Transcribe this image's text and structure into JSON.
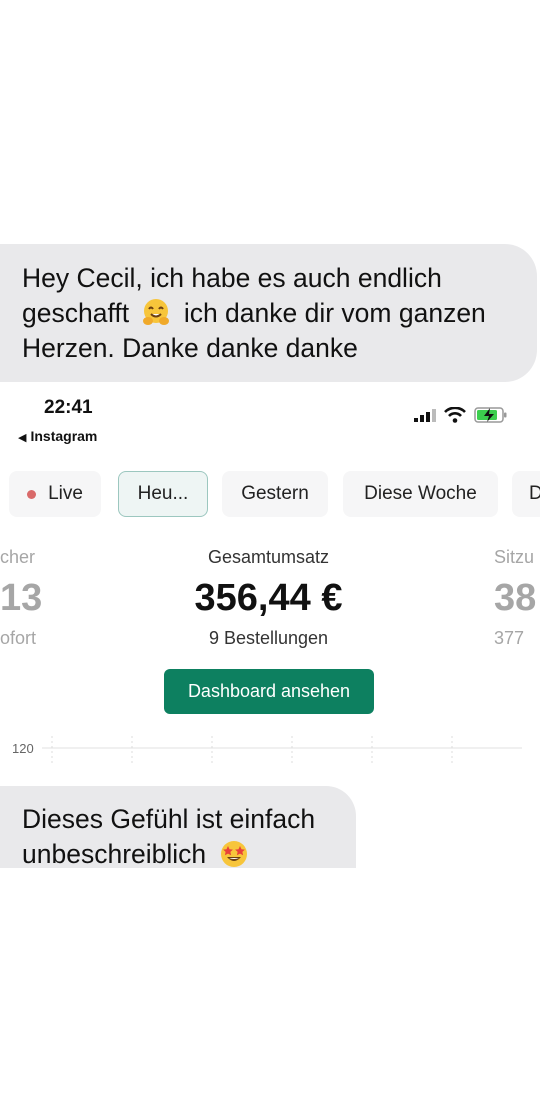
{
  "messages": {
    "first": {
      "line1": "Hey Cecil, ich habe es auch endlich",
      "line2_before": "geschafft",
      "line2_after": "ich danke dir vom ganzen",
      "line3": "Herzen. Danke danke danke"
    },
    "second": {
      "line1": "Dieses Gefühl ist einfach",
      "line2": "unbeschreiblich"
    }
  },
  "status_bar": {
    "time": "22:41",
    "back_app": "Instagram"
  },
  "filters": {
    "live": "Live",
    "today": "Heu...",
    "yesterday": "Gestern",
    "this_week": "Diese Woche",
    "next_cut": "D"
  },
  "stats": {
    "left": {
      "label": "cher",
      "value": "13",
      "sub": "ofort"
    },
    "center": {
      "label": "Gesamtumsatz",
      "value": "356,44 €",
      "sub": "9 Bestellungen"
    },
    "right": {
      "label": "Sitzu",
      "value": "38",
      "sub": "377"
    }
  },
  "actions": {
    "dashboard": "Dashboard ansehen"
  },
  "chart": {
    "y_tick": "120"
  },
  "colors": {
    "bubble": "#e9e9eb",
    "accent": "#0d8060",
    "live": "#d96a6a"
  }
}
